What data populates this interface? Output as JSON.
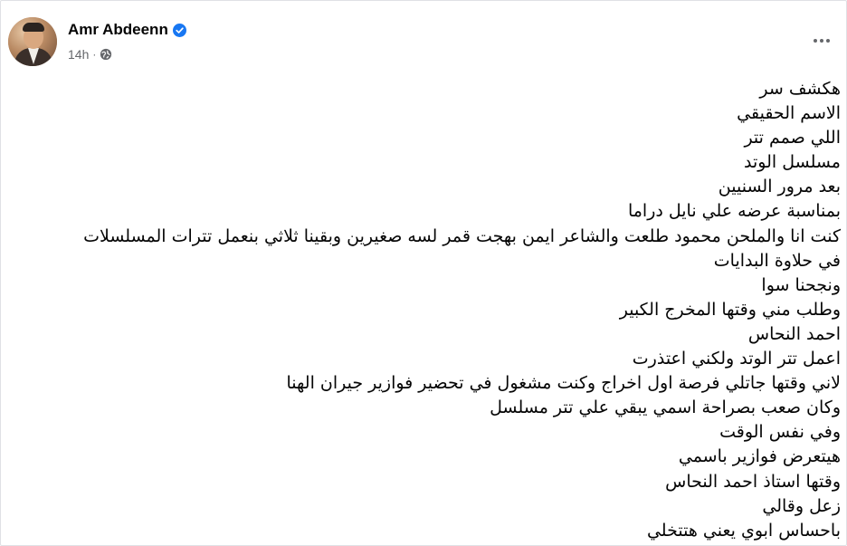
{
  "post": {
    "author": "Amr Abdeenn",
    "verified_icon": "verified-badge-icon",
    "time": "14h",
    "separator": "·",
    "privacy_icon": "globe-icon",
    "menu_icon": "more-options-icon",
    "lines": [
      "هكشف سر",
      "الاسم الحقيقي",
      "اللي صمم تتر",
      "مسلسل الوتد",
      "بعد مرور السنيين",
      "بمناسبة عرضه علي نايل دراما",
      "كنت انا والملحن محمود طلعت والشاعر ايمن بهجت قمر لسه صغيرين وبقينا ثلاثي بنعمل تترات المسلسلات",
      "في حلاوة البدايات",
      "ونجحنا سوا",
      "وطلب مني وقتها المخرج الكبير",
      "احمد النحاس",
      "اعمل تتر الوتد ولكني اعتذرت",
      "لاني وقتها جاتلي فرصة اول اخراج وكنت مشغول في  تحضير فوازير جيران الهنا",
      "وكان  صعب  بصراحة اسمي يبقي علي تتر مسلسل",
      "وفي نفس الوقت",
      "هيتعرض فوازير باسمي",
      "وقتها استاذ احمد النحاس",
      "زعل وقالي",
      "باحساس ابوي يعني هتتخلي"
    ]
  },
  "colors": {
    "primary_text": "#050505",
    "secondary_text": "#65676b",
    "verified_blue": "#1877f2"
  }
}
